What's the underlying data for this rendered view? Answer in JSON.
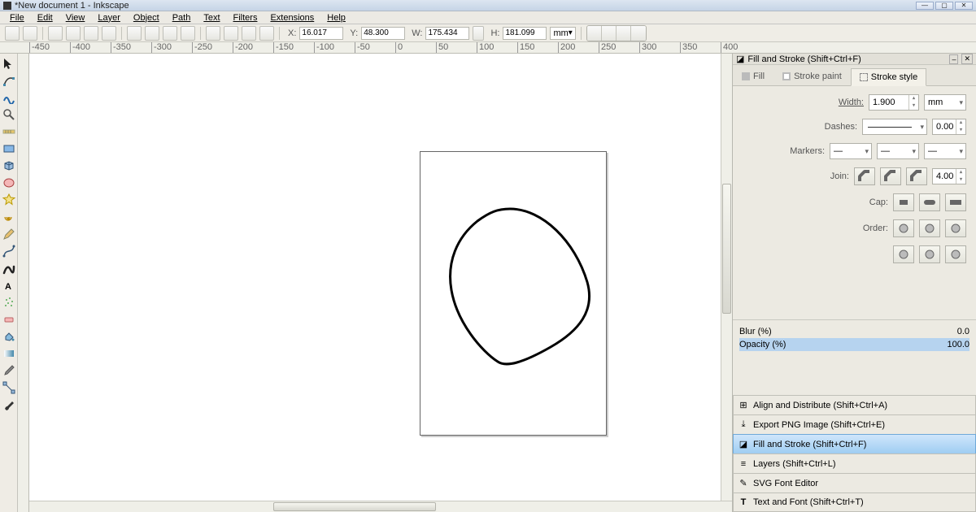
{
  "window": {
    "title": "*New document 1 - Inkscape"
  },
  "menu": [
    "File",
    "Edit",
    "View",
    "Layer",
    "Object",
    "Path",
    "Text",
    "Filters",
    "Extensions",
    "Help"
  ],
  "optbar": {
    "x_label": "X:",
    "x": "16.017",
    "y_label": "Y:",
    "y": "48.300",
    "w_label": "W:",
    "w": "175.434",
    "h_label": "H:",
    "h": "181.099",
    "unit": "mm"
  },
  "ruler_h": [
    "-450",
    "-400",
    "-350",
    "-300",
    "-250",
    "-200",
    "-150",
    "-100",
    "-50",
    "0",
    "50",
    "100",
    "150",
    "200",
    "250",
    "300",
    "350",
    "400"
  ],
  "tools": [
    "arrow",
    "node",
    "tweak",
    "zoom",
    "measure",
    "rect",
    "3dbox",
    "circle",
    "star",
    "spiral",
    "pencil",
    "bezier",
    "calligraphy",
    "text",
    "spray",
    "eraser",
    "bucket",
    "gradient",
    "dropper",
    "connector"
  ],
  "dock": {
    "title": "Fill and Stroke (Shift+Ctrl+F)",
    "tabs": {
      "fill": "Fill",
      "stroke_paint": "Stroke paint",
      "stroke_style": "Stroke style"
    },
    "stroke": {
      "width_label": "Width:",
      "width": "1.900",
      "unit": "mm",
      "dashes_label": "Dashes:",
      "dash_offset": "0.00",
      "markers_label": "Markers:",
      "join_label": "Join:",
      "join_miter": "4.00",
      "cap_label": "Cap:",
      "order_label": "Order:"
    },
    "blur_label": "Blur (%)",
    "blur": "0.0",
    "opacity_label": "Opacity (%)",
    "opacity": "100.0",
    "panels": [
      "Align and Distribute (Shift+Ctrl+A)",
      "Export PNG Image (Shift+Ctrl+E)",
      "Fill and Stroke (Shift+Ctrl+F)",
      "Layers (Shift+Ctrl+L)",
      "SVG Font Editor",
      "Text and Font (Shift+Ctrl+T)"
    ]
  }
}
